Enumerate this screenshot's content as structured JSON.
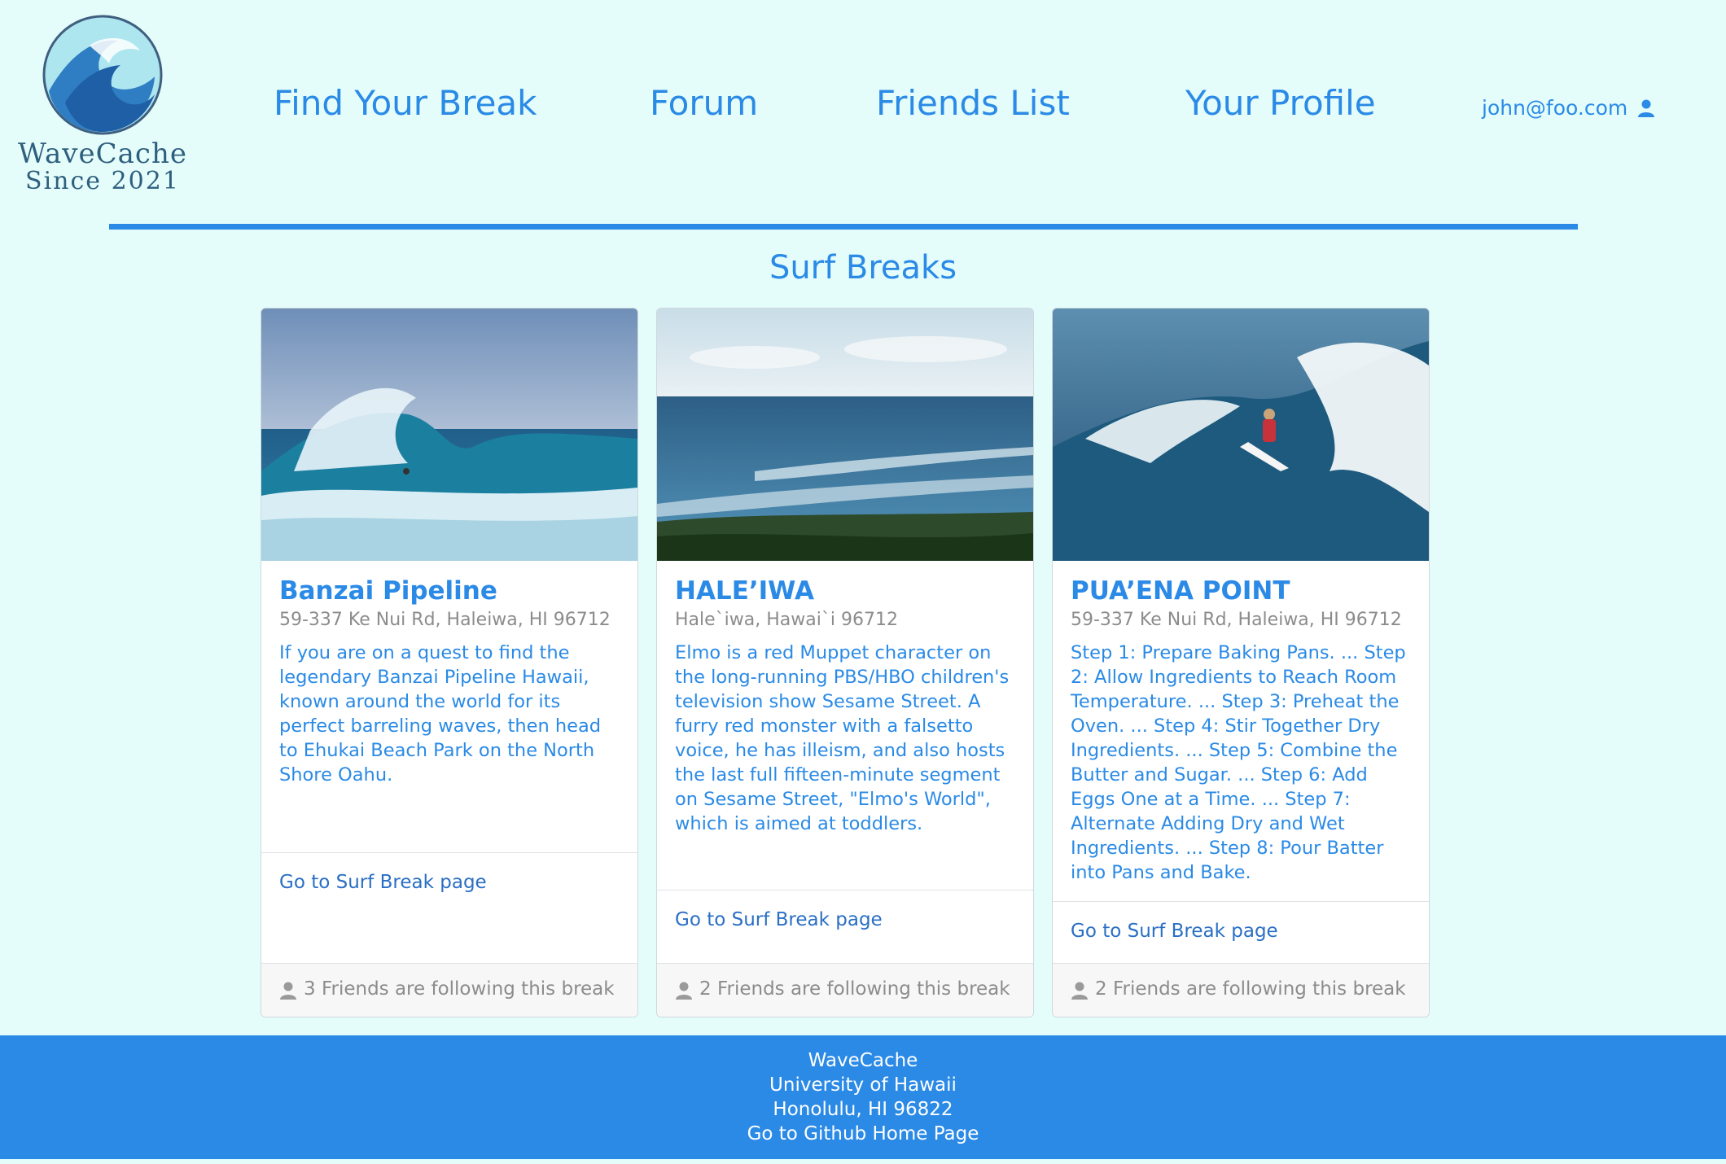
{
  "brand": {
    "name": "WaveCache",
    "since": "Since 2021"
  },
  "nav": {
    "find_break": "Find Your Break",
    "forum": "Forum",
    "friends_list": "Friends List",
    "your_profile": "Your Profile",
    "user_email": "john@foo.com"
  },
  "page": {
    "title": "Surf Breaks"
  },
  "cards": [
    {
      "title": "Banzai Pipeline",
      "address": "59-337 Ke Nui Rd, Haleiwa, HI 96712",
      "description": "If you are on a quest to find the legendary Banzai Pipeline Hawaii, known around the world for its perfect barreling waves, then head to Ehukai Beach Park on the North Shore Oahu.",
      "link": "Go to Surf Break page",
      "followers": "3 Friends are following this break"
    },
    {
      "title": "HALE’IWA",
      "address": "Hale`iwa, Hawai`i 96712",
      "description": "Elmo is a red Muppet character on the long-running PBS/HBO children's television show Sesame Street. A furry red monster with a falsetto voice, he has illeism, and also hosts the last full fifteen-minute segment on Sesame Street, \"Elmo's World\", which is aimed at toddlers.",
      "link": "Go to Surf Break page",
      "followers": "2 Friends are following this break"
    },
    {
      "title": "PUA’ENA POINT",
      "address": "59-337 Ke Nui Rd, Haleiwa, HI 96712",
      "description": "Step 1: Prepare Baking Pans. ... Step 2: Allow Ingredients to Reach Room Temperature. ... Step 3: Preheat the Oven. ... Step 4: Stir Together Dry Ingredients. ... Step 5: Combine the Butter and Sugar. ... Step 6: Add Eggs One at a Time. ... Step 7: Alternate Adding Dry and Wet Ingredients. ... Step 8: Pour Batter into Pans and Bake.",
      "link": "Go to Surf Break page",
      "followers": "2 Friends are following this break"
    }
  ],
  "footer": {
    "line1": "WaveCache",
    "line2": "University of Hawaii",
    "line3": "Honolulu, HI 96822",
    "link": "Go to Github Home Page"
  },
  "icons": {
    "logo": "wave-logo-icon",
    "user": "user-icon",
    "friends": "user-icon"
  },
  "colors": {
    "accent": "#2a8ae6",
    "background": "#e4fdfb"
  }
}
